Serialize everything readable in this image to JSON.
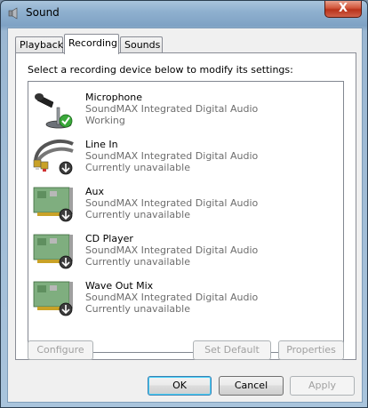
{
  "window": {
    "title": "Sound",
    "close_label": "X"
  },
  "tabs": [
    {
      "label": "Playback",
      "active": false
    },
    {
      "label": "Recording",
      "active": true
    },
    {
      "label": "Sounds",
      "active": false
    }
  ],
  "instruction": "Select a recording device below to modify its settings:",
  "devices": [
    {
      "name": "Microphone",
      "driver": "SoundMAX Integrated Digital Audio",
      "status": "Working",
      "icon": "microphone-icon",
      "badge": "check"
    },
    {
      "name": "Line In",
      "driver": "SoundMAX Integrated Digital Audio",
      "status": "Currently unavailable",
      "icon": "line-in-cable-icon",
      "badge": "down-arrow"
    },
    {
      "name": "Aux",
      "driver": "SoundMAX Integrated Digital Audio",
      "status": "Currently unavailable",
      "icon": "sound-card-icon",
      "badge": "down-arrow"
    },
    {
      "name": "CD Player",
      "driver": "SoundMAX Integrated Digital Audio",
      "status": "Currently unavailable",
      "icon": "sound-card-icon",
      "badge": "down-arrow"
    },
    {
      "name": "Wave Out Mix",
      "driver": "SoundMAX Integrated Digital Audio",
      "status": "Currently unavailable",
      "icon": "sound-card-icon",
      "badge": "down-arrow"
    }
  ],
  "buttons": {
    "configure": "Configure",
    "set_default": "Set Default",
    "properties": "Properties",
    "ok": "OK",
    "cancel": "Cancel",
    "apply": "Apply"
  }
}
